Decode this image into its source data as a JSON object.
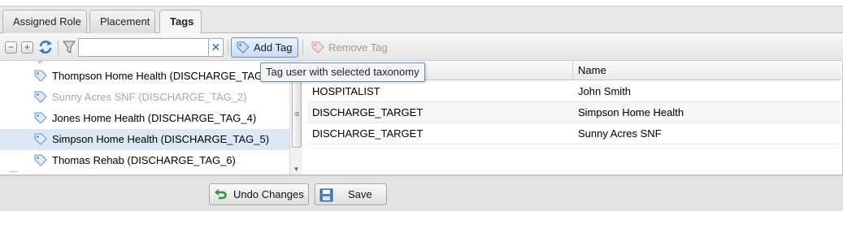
{
  "tabs": [
    {
      "label": "Assigned Role",
      "active": false
    },
    {
      "label": "Placement",
      "active": false
    },
    {
      "label": "Tags",
      "active": true
    }
  ],
  "toolbar": {
    "collapse_icon": "minus-icon",
    "expand_icon": "plus-icon",
    "refresh_icon": "refresh-icon",
    "filter_icon": "filter-icon",
    "filter_value": "",
    "clear_symbol": "✕",
    "add_tag_label": "Add Tag",
    "remove_tag_label": "Remove Tag"
  },
  "tooltip": "Tag user with selected taxonomy",
  "tree": {
    "items": [
      {
        "label": "Thompson Home Health (DISCHARGE_TAG_1)",
        "state": "normal"
      },
      {
        "label": "Sunny Acres SNF (DISCHARGE_TAG_2)",
        "state": "disabled"
      },
      {
        "label": "Jones Home Health (DISCHARGE_TAG_4)",
        "state": "normal"
      },
      {
        "label": "Simpson Home Health (DISCHARGE_TAG_5)",
        "state": "selected"
      },
      {
        "label": "Thomas Rehab (DISCHARGE_TAG_6)",
        "state": "normal"
      }
    ]
  },
  "grid": {
    "columns": [
      "",
      "Name"
    ],
    "rows": [
      [
        "HOSPITALIST",
        "John Smith"
      ],
      [
        "DISCHARGE_TARGET",
        "Simpson Home Health"
      ],
      [
        "DISCHARGE_TARGET",
        "Sunny Acres SNF"
      ]
    ]
  },
  "footer": {
    "undo_label": "Undo Changes",
    "save_label": "Save"
  },
  "colors": {
    "accent": "#2a63b5",
    "selected_row": "#dde8f6",
    "disabled_text": "#a8a8a8"
  }
}
